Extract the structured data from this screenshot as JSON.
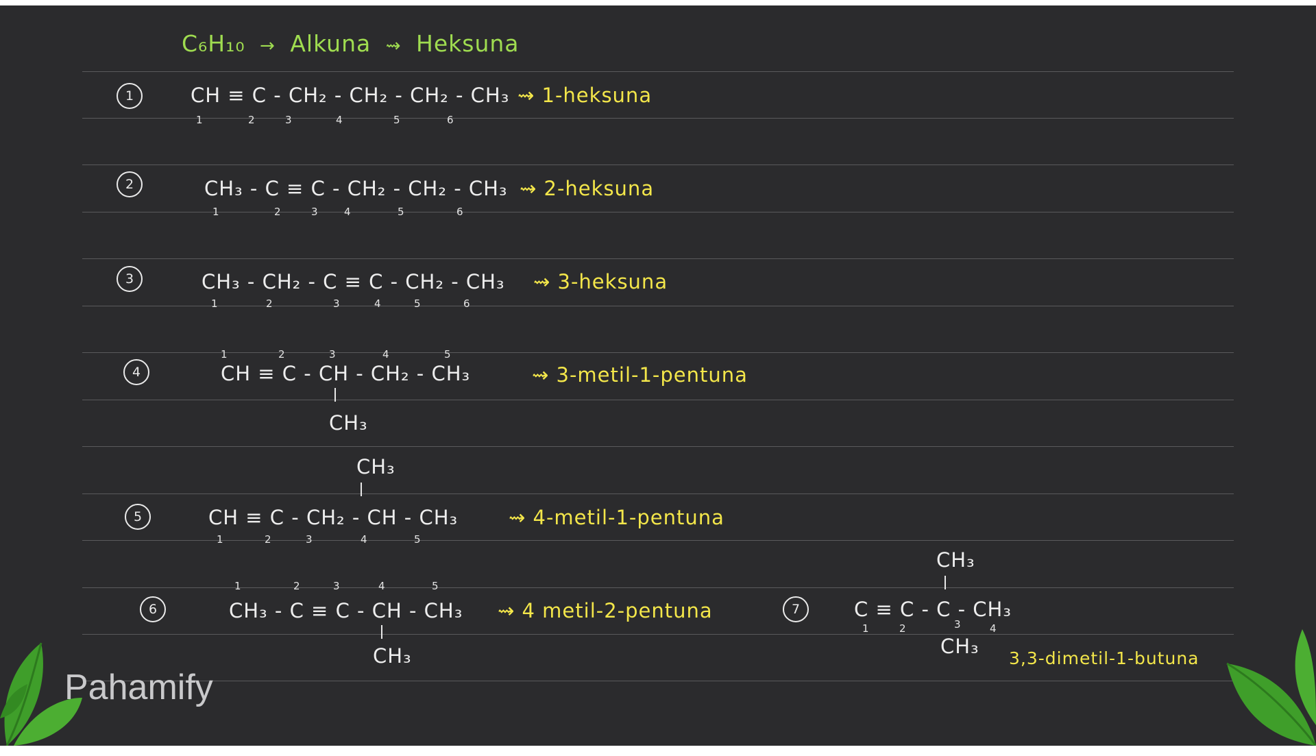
{
  "header": {
    "formula": "C₆H₁₀",
    "arrow1": "→",
    "class": "Alkuna",
    "arrow2": "⇝",
    "name": "Heksuna"
  },
  "rows": [
    {
      "num": "1",
      "formula": "CH ≡ C - CH₂ - CH₂ - CH₂ - CH₃",
      "name": "⇝ 1-heksuna",
      "positions": [
        "1",
        "2",
        "3",
        "4",
        "5",
        "6"
      ]
    },
    {
      "num": "2",
      "formula": "CH₃ - C ≡ C - CH₂ - CH₂ - CH₃",
      "name": "⇝ 2-heksuna",
      "positions": [
        "1",
        "2",
        "3",
        "4",
        "5",
        "6"
      ]
    },
    {
      "num": "3",
      "formula": "CH₃ - CH₂ - C ≡ C - CH₂ - CH₃",
      "name": "⇝ 3-heksuna",
      "positions": [
        "1",
        "2",
        "3",
        "4",
        "5",
        "6"
      ]
    },
    {
      "num": "4",
      "formula": "CH ≡ C - CH - CH₂ - CH₃",
      "branch": "CH₃",
      "name": "⇝ 3-metil-1-pentuna",
      "positions": [
        "1",
        "2",
        "3",
        "4",
        "5"
      ]
    },
    {
      "num": "5",
      "formula": "CH ≡ C - CH₂ - CH - CH₃",
      "branch": "CH₃",
      "name": "⇝ 4-metil-1-pentuna",
      "positions": [
        "1",
        "2",
        "3",
        "4",
        "5"
      ]
    },
    {
      "num": "6",
      "formula": "CH₃ - C ≡ C - CH - CH₃",
      "branch": "CH₃",
      "name": "⇝ 4 metil-2-pentuna",
      "positions": [
        "1",
        "2",
        "3",
        "4",
        "5"
      ]
    },
    {
      "num": "7",
      "formula": "C ≡ C - C - CH₃",
      "branch_top": "CH₃",
      "branch_bottom": "CH₃",
      "name": "3,3-dimetil-1-butuna",
      "positions": [
        "1",
        "2",
        "3",
        "4"
      ]
    }
  ],
  "brand": {
    "logo": "Pahamify"
  },
  "colors": {
    "board": "#2b2b2d",
    "formula": "#ededed",
    "name": "#f3e64a",
    "header": "#9fdc50",
    "leaf": "#3f9e2a"
  },
  "icons": [
    "leaf-left-icon",
    "leaf-right-icon"
  ]
}
